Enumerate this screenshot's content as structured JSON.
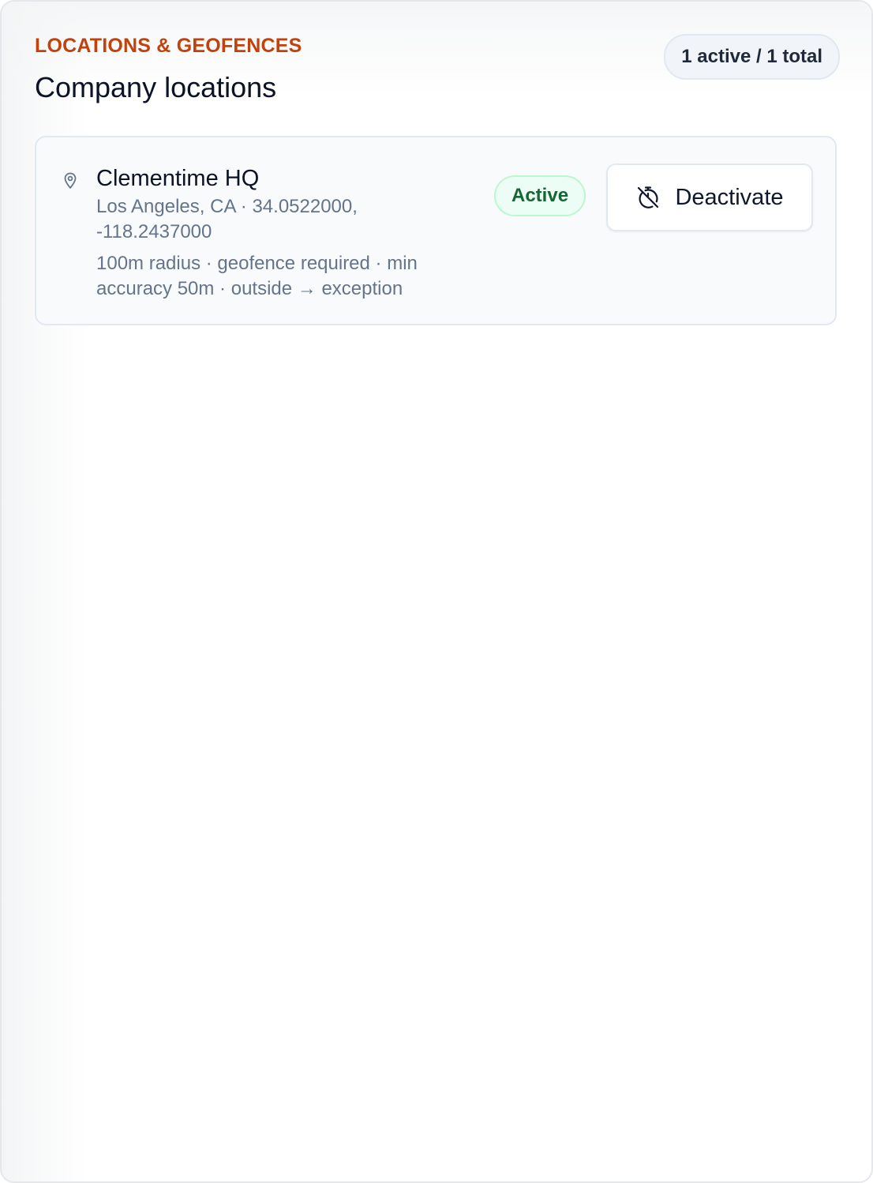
{
  "header": {
    "eyebrow": "LOCATIONS & GEOFENCES",
    "title": "Company locations",
    "count_pill": "1 active / 1 total"
  },
  "locations": [
    {
      "name": "Clementime HQ",
      "coords": "Los Angeles, CA · 34.0522000, -118.2437000",
      "rules": "100m radius · geofence required · min accuracy 50m · outside → exception",
      "status": "Active",
      "action_label": "Deactivate",
      "icon": "map-pin-icon",
      "action_icon": "timer-off-icon"
    }
  ],
  "colors": {
    "eyebrow": "#c2410c",
    "active_text": "#166534",
    "active_bg": "#ecfdf5"
  }
}
